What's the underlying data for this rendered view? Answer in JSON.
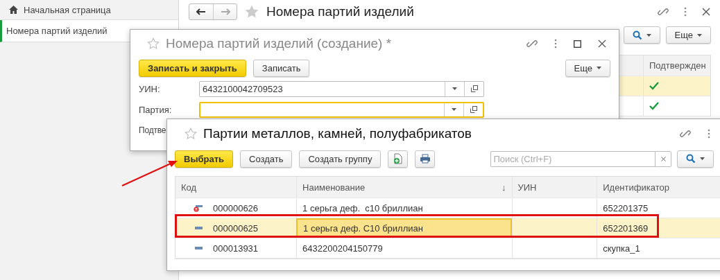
{
  "sidebar": {
    "items": [
      {
        "label": "Начальная страница",
        "kind": "home",
        "selected": false
      },
      {
        "label": "Номера партий изделий",
        "kind": "page",
        "selected": true
      }
    ]
  },
  "main_window": {
    "title": "Номера партий изделий",
    "more_button": "Еще",
    "table": {
      "columns": [
        "Подтвержден"
      ],
      "rows": [
        {
          "selected": true,
          "confirmed": true
        },
        {
          "selected": false,
          "confirmed": true
        }
      ]
    }
  },
  "create_dialog": {
    "title": "Номера партий изделий (создание) *",
    "buttons": [
      {
        "label": "Записать и закрыть",
        "kind": "primary"
      },
      {
        "label": "Записать",
        "kind": "normal"
      }
    ],
    "more_button": "Еще",
    "fields": [
      {
        "label": "УИН:",
        "value": "6432100042709523",
        "focused": false
      },
      {
        "label": "Партия:",
        "focused": true
      },
      {
        "label": "Подтве"
      }
    ]
  },
  "select_dialog": {
    "title": "Партии металлов, камней, полуфабрикатов",
    "buttons": [
      {
        "label": "Выбрать",
        "kind": "primary",
        "annotated": true
      },
      {
        "label": "Создать",
        "kind": "normal"
      },
      {
        "label": "Создать группу",
        "kind": "normal"
      },
      {
        "kind": "add-document"
      },
      {
        "kind": "print"
      }
    ],
    "search": {
      "placeholder": "Поиск (Ctrl+F)"
    },
    "table": {
      "columns": [
        {
          "label": "Код"
        },
        {
          "label": "Наименование",
          "sort": "↓"
        },
        {
          "label": "УИН"
        },
        {
          "label": "Идентификатор"
        }
      ],
      "rows": [
        {
          "kind": "deleted",
          "selected": false,
          "cells": [
            {
              "text": "000000626",
              "focused": false
            },
            {
              "text": "1 серьга деф.  с10 бриллиан",
              "focused": false
            },
            {
              "focused": false
            },
            {
              "text": "652201375",
              "focused": false
            }
          ]
        },
        {
          "kind": "item",
          "selected": true,
          "annotated": true,
          "cells": [
            {
              "text": "000000625",
              "focused": false
            },
            {
              "text": "1 серьга деф. С10 бриллиан",
              "focused": true
            },
            {
              "focused": false
            },
            {
              "text": "652201369",
              "focused": false
            }
          ]
        },
        {
          "kind": "item",
          "selected": false,
          "cells": [
            {
              "text": "000013931",
              "focused": false
            },
            {
              "text": "6432200204150779",
              "focused": false
            },
            {
              "focused": false
            },
            {
              "text": "скупка_1",
              "focused": false
            }
          ]
        }
      ]
    }
  }
}
